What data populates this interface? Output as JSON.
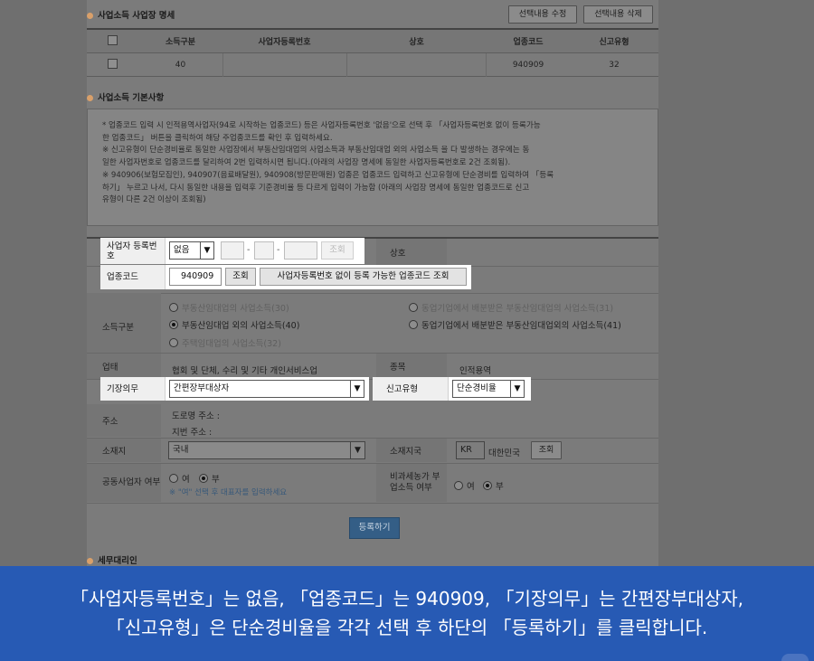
{
  "business_section": {
    "title": "사업소득 사업장 명세",
    "edit_button": "선택내용 수정",
    "delete_button": "선택내용 삭제",
    "columns": [
      "소득구분",
      "사업자등록번호",
      "상호",
      "업종코드",
      "신고유형"
    ],
    "rows": [
      {
        "income_type": "40",
        "reg_no": "",
        "name": "",
        "industry_code": "940909",
        "report_type": "32"
      }
    ]
  },
  "basic_section": {
    "title": "사업소득 기본사항",
    "notes": [
      "* 업종코드 입력 시 인적용역사업자(94로 시작하는 업종코드) 등은 사업자등록번호 '없음'으로 선택 후 「사업자등록번호 없이 등록가능",
      "한 업종코드」 버튼을 클릭하여 해당 주업종코드를 확인 후 입력하세요.",
      "※ 신고유형이 단순경비율로 동일한 사업장에서 부동산임대업의 사업소득과 부동산임대업 외의 사업소득 을 다 발생하는 경우에는 동",
      "일한 사업자번호로 업종코드를 달리하여 2번 입력하시면 됩니다.(아래의 사업장 명세에 동일한 사업자등록번호로 2건 조회됨).",
      "※ 940906(보험모집인), 940907(음료배달원), 940908(방문판매원) 업종은 업종코드 입력하고 신고유형에 단순경비를 입력하여 「등록",
      "하기」 누르고 나서, 다시 동일한 내용을 입력후 기준경비율 등 다르게 입력이 가능함 (아래의 사업장 명세에 동일한 업종코드로 신고",
      "유형이 다른 2건 이상이 조회됨)"
    ]
  },
  "form": {
    "reg_no_label": "사업자 등록번호",
    "reg_no_select": "없음",
    "reg_no_dash": "-",
    "reg_no_lookup": "조회",
    "trade_name_label": "상호",
    "industry_code_label": "업종코드",
    "industry_code_value": "940909",
    "industry_lookup": "조회",
    "industry_nonreg_button": "사업자등록번호 없이 등록 가능한 업종코드 조회",
    "income_type_label": "소득구분",
    "income_options": [
      "부동산임대업의 사업소득(30)",
      "동업기업에서 배분받은 부동산임대업의 사업소득(31)",
      "부동산임대업 외의 사업소득(40)",
      "동업기업에서 배분받은 부동산임대업외의 사업소득(41)",
      "주택임대업의 사업소득(32)"
    ],
    "business_type_label": "업태",
    "business_type_value": "협회 및 단체, 수리 및 기타 개인서비스업",
    "item_label": "종목",
    "item_value": "인적용역",
    "bookkeeping_label": "기장의무",
    "bookkeeping_value": "간편장부대상자",
    "report_type_label": "신고유형",
    "report_type_value": "단순경비율",
    "address_label": "주소",
    "road_address": "도로명 주소 :",
    "lot_address": "지번 주소 :",
    "location_label": "소재지",
    "location_value": "국내",
    "country_label": "소재지국",
    "country_code": "KR",
    "country_name": "대한민국",
    "country_lookup": "조회",
    "joint_label": "공동사업자 여부",
    "joint_yes": "여",
    "joint_no": "부",
    "joint_hint": "※ \"여\" 선택 후 대표자를 입력하세요",
    "farm_label": "비과세농가 부업소득 여부",
    "farm_yes": "여",
    "farm_no": "부",
    "register_button": "등록하기"
  },
  "agent_section": {
    "title": "세무대리인"
  },
  "caption": {
    "line1": "「사업자등록번호」는 없음, 「업종코드」는 940909, 「기장의무」는 간편장부대상자,",
    "line2": "「신고유형」은 단순경비율을 각각 선택 후 하단의 「등록하기」를 클릭합니다."
  }
}
